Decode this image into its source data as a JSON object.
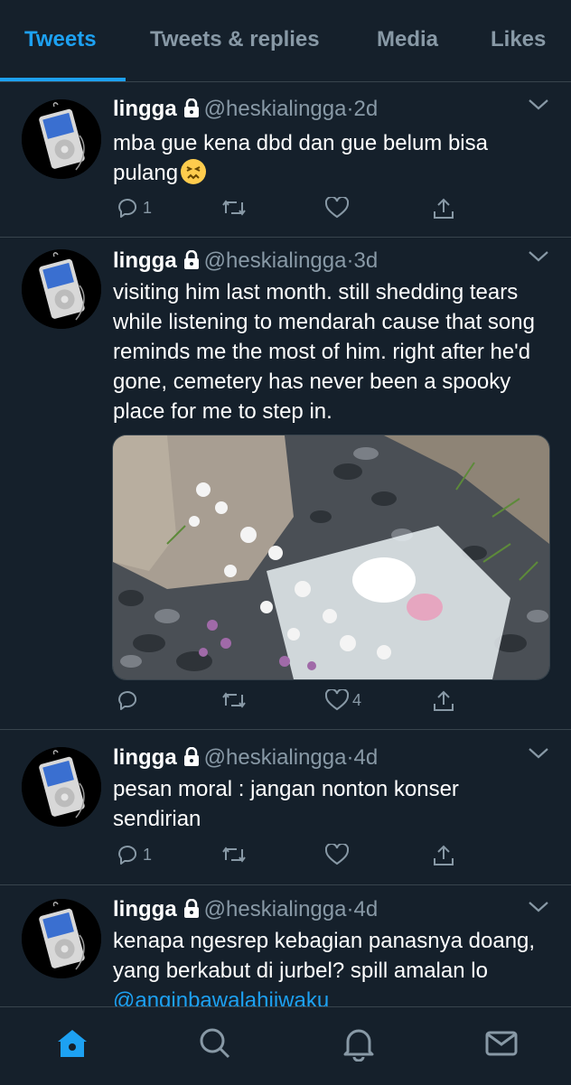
{
  "tabs": [
    {
      "label": "Tweets",
      "active": true
    },
    {
      "label": "Tweets & replies",
      "active": false
    },
    {
      "label": "Media",
      "active": false
    },
    {
      "label": "Likes",
      "active": false
    }
  ],
  "colors": {
    "accent": "#1da1f2",
    "background": "#15202b",
    "muted": "#8899a6",
    "divider": "#38444d"
  },
  "tweets": [
    {
      "name": "lingga",
      "handle": "@heskialingga",
      "dot": "·",
      "time": "2d",
      "text": "mba gue kena dbd dan gue belum bisa pulang",
      "emoji": "confounded-face",
      "replies": "1",
      "retweets": "",
      "likes": ""
    },
    {
      "name": "lingga",
      "handle": "@heskialingga",
      "dot": "·",
      "time": "3d",
      "text": "visiting him last month. still shedding tears while listening to mendarah cause that song reminds me the most of him. right after he'd gone, cemetery has never been a spooky place for me to step in.",
      "media": "photo of flowers bouquet beside a gravestone",
      "replies": "",
      "retweets": "",
      "likes": "4"
    },
    {
      "name": "lingga",
      "handle": "@heskialingga",
      "dot": "·",
      "time": "4d",
      "text": "pesan moral : jangan nonton konser sendirian",
      "replies": "1",
      "retweets": "",
      "likes": ""
    },
    {
      "name": "lingga",
      "handle": "@heskialingga",
      "dot": "·",
      "time": "4d",
      "text": "kenapa ngesrep kebagian panasnya doang, yang berkabut di jurbel? spill amalan lo ",
      "mention": "@anginbawalahiiwaku",
      "replies": "",
      "retweets": "",
      "likes": ""
    }
  ],
  "bottom_nav": [
    "home-icon",
    "search-icon",
    "bell-icon",
    "mail-icon"
  ]
}
